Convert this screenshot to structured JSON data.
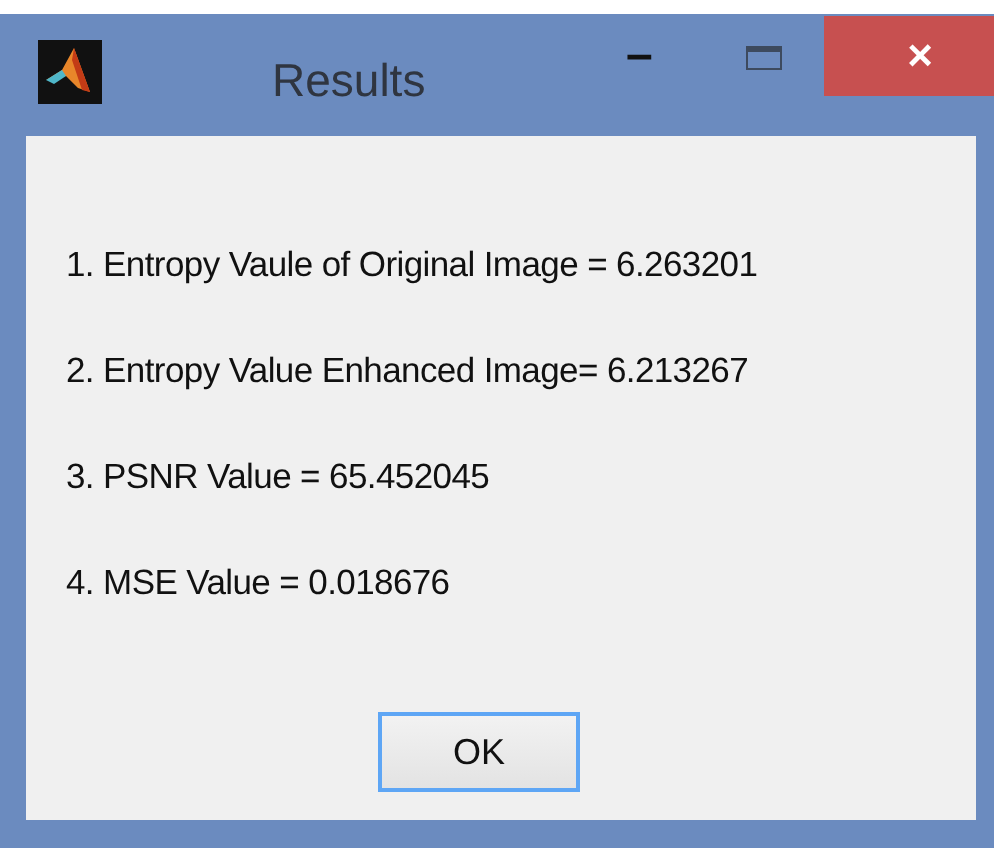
{
  "window": {
    "title": "Results",
    "controls": [
      "–",
      "×"
    ]
  },
  "lines": [
    "1. Entropy Vaule of Original Image = 6.263201",
    "2. Entropy Value Enhanced Image= 6.213267",
    "3. PSNR Value = 65.452045",
    "4. MSE Value = 0.018676"
  ],
  "buttons": [
    {
      "label": "OK",
      "selected": true
    }
  ]
}
